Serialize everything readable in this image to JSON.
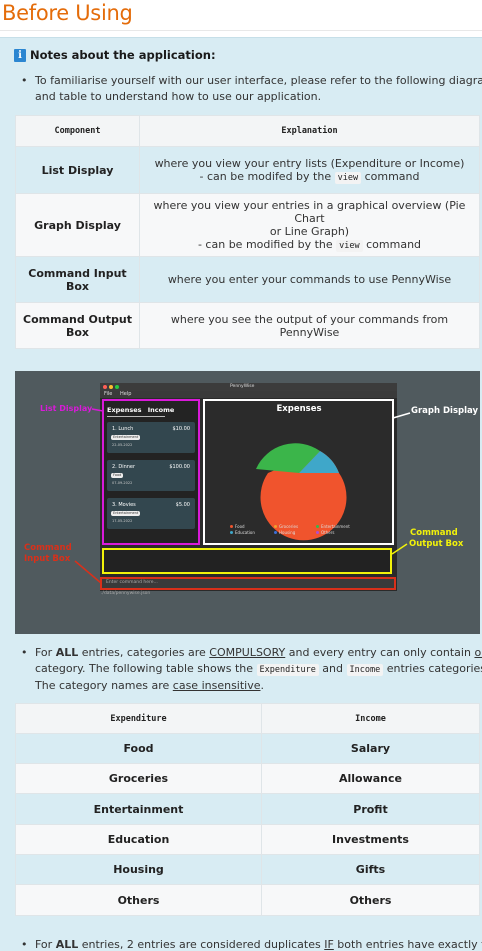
{
  "page": {
    "title": "Before Using"
  },
  "notes": {
    "header": "Notes about the application:",
    "bullet1_line1": "To familiarise yourself with our user interface, please refer to the following diagram",
    "bullet1_line2": "and table to understand how to use our application."
  },
  "components_table": {
    "headers": [
      "Component",
      "Explanation"
    ],
    "rows": [
      {
        "name": "List Display",
        "desc_line1": "where you view your entry lists (Expenditure or Income)",
        "desc_line2_pre": "- can be modifed by the ",
        "desc_code": "view",
        "desc_line2_post": " command"
      },
      {
        "name": "Graph Display",
        "desc_line1": "where you view your entries in a graphical overview (Pie Chart",
        "desc_line2": "or Line Graph)",
        "desc_line3_pre": "- can be modified by the ",
        "desc_code": "view",
        "desc_line3_post": " command"
      },
      {
        "name_line1": "Command Input",
        "name_line2": "Box",
        "desc_line1": "where you enter your commands to use PennyWise"
      },
      {
        "name_line1": "Command Output",
        "name_line2": "Box",
        "desc_line1": "where you see the output of your commands from PennyWise"
      }
    ]
  },
  "diagram": {
    "app_title": "PennyWise",
    "menu": [
      "File",
      "Help"
    ],
    "tabs": [
      "Expenses",
      "Income"
    ],
    "entries": [
      {
        "name": "1. Lunch",
        "amount": "$10.00",
        "category": "Entertainment",
        "date": "22-05-2022"
      },
      {
        "name": "2. Dinner",
        "amount": "$100.00",
        "category": "Food",
        "date": "07-09-2022"
      },
      {
        "name": "3. Movies",
        "amount": "$5.00",
        "category": "Entertainment",
        "date": "17-05-2022"
      }
    ],
    "graph_title": "Expenses",
    "legend": [
      "Food",
      "Groceries",
      "Entertainment",
      "Education",
      "Housing",
      "Others"
    ],
    "colors": {
      "food": "#f0542d",
      "groceries": "#f0a02d",
      "entertainment": "#3bb54a",
      "education": "#3fa7c9",
      "housing": "#3b6fd6",
      "others": "#b04fd1"
    },
    "input_placeholder": "Enter command here...",
    "status_path": "./data/pennywise.json",
    "callouts": {
      "list": "List Display",
      "graph": "Graph Display",
      "output_line1": "Command",
      "output_line2": "Output Box",
      "input_line1": "Command",
      "input_line2": "Input Box"
    }
  },
  "bullet2": {
    "pre1": "For ",
    "all": "ALL",
    "mid1": " entries, categories are ",
    "compulsory": "COMPULSORY",
    "mid2": " and every entry can only contain ",
    "one": "one",
    "line2_pre": "category. The following table shows the ",
    "code1": "Expenditure",
    "and": " and ",
    "code2": "Income",
    "line2_post": " entries categories.",
    "line3_pre": "The category names are ",
    "case_insensitive": "case insensitive",
    "line3_post": "."
  },
  "categories_table": {
    "headers": [
      "Expenditure",
      "Income"
    ],
    "rows": [
      [
        "Food",
        "Salary"
      ],
      [
        "Groceries",
        "Allowance"
      ],
      [
        "Entertainment",
        "Profit"
      ],
      [
        "Education",
        "Investments"
      ],
      [
        "Housing",
        "Gifts"
      ],
      [
        "Others",
        "Others"
      ]
    ]
  },
  "bullet3": {
    "pre": "For ",
    "all": "ALL",
    "mid": " entries, 2 entries are considered duplicates ",
    "if": "IF",
    "post": " both entries have exactly the"
  }
}
